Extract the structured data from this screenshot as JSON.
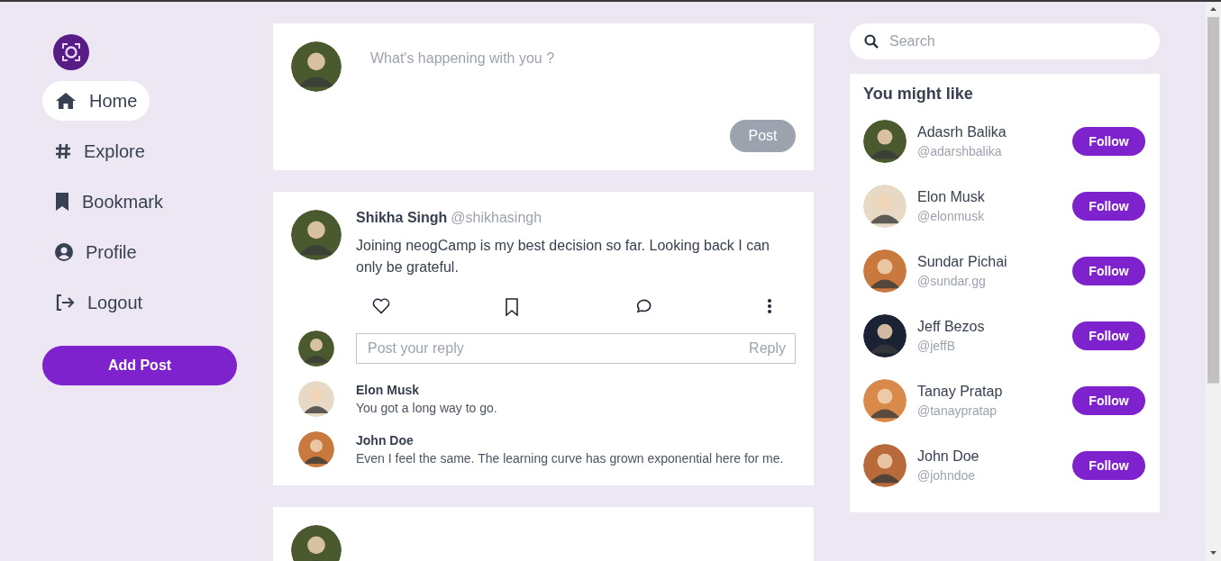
{
  "sidebar": {
    "nav": [
      {
        "kind": "home",
        "label": "Home",
        "selected": true
      },
      {
        "kind": "explore",
        "label": "Explore",
        "selected": false
      },
      {
        "kind": "bookmark",
        "label": "Bookmark",
        "selected": false
      },
      {
        "kind": "profile",
        "label": "Profile",
        "selected": false
      },
      {
        "kind": "logout",
        "label": "Logout",
        "selected": false
      }
    ],
    "add_post": "Add Post"
  },
  "composer": {
    "placeholder": "What's happening with you ?",
    "button": "Post"
  },
  "post": {
    "name": "Shikha Singh",
    "handle": "@shikhasingh",
    "text": "Joining neogCamp is my best decision so far. Looking back I can only be grateful.",
    "reply_placeholder": "Post your reply",
    "reply_button": "Reply",
    "comments": [
      {
        "name": "Elon Musk",
        "text": "You got a long way to go."
      },
      {
        "name": "John Doe",
        "text": "Even I feel the same. The learning curve has grown exponential here for me."
      }
    ]
  },
  "search": {
    "placeholder": "Search"
  },
  "suggestions": {
    "title": "You might like",
    "users": [
      {
        "name": "Adasrh Balika",
        "handle": "@adarshbalika",
        "button": "Follow"
      },
      {
        "name": "Elon Musk",
        "handle": "@elonmusk",
        "button": "Follow"
      },
      {
        "name": "Sundar Pichai",
        "handle": "@sundar.gg",
        "button": "Follow"
      },
      {
        "name": "Jeff Bezos",
        "handle": "@jeffB",
        "button": "Follow"
      },
      {
        "name": "Tanay Pratap",
        "handle": "@tanaypratap",
        "button": "Follow"
      },
      {
        "name": "John Doe",
        "handle": "@johndoe",
        "button": "Follow"
      }
    ]
  }
}
